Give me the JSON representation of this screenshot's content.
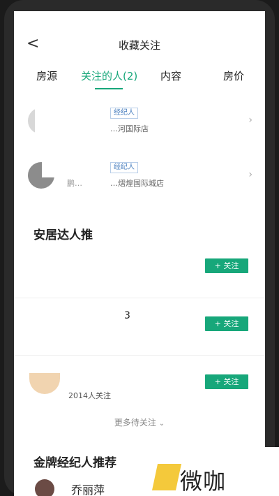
{
  "header": {
    "title": "收藏关注",
    "back_glyph": "<"
  },
  "tabs": [
    {
      "label": "房源"
    },
    {
      "label": "关注的人(2)"
    },
    {
      "label": "内容"
    },
    {
      "label": "房价"
    }
  ],
  "followed_agents": [
    {
      "tag": "经纪人",
      "store": "…河国际店",
      "partial_name": ""
    },
    {
      "tag": "经纪人",
      "store": "…熠煌国际城店",
      "partial_name": "鹏…"
    }
  ],
  "talent_section": {
    "title": "安居达人推",
    "items": [
      {
        "follow_label": "+ 关注"
      },
      {
        "follow_label": "+ 关注",
        "partial_name": "3"
      },
      {
        "follow_label": "+ 关注",
        "followers": "2014人关注"
      }
    ],
    "more_label": "更多待关注"
  },
  "gold_section": {
    "title": "金牌经纪人推荐",
    "partial_name": "乔丽萍"
  },
  "watermark": {
    "text": "微咖"
  },
  "colors": {
    "accent": "#17a77a"
  }
}
